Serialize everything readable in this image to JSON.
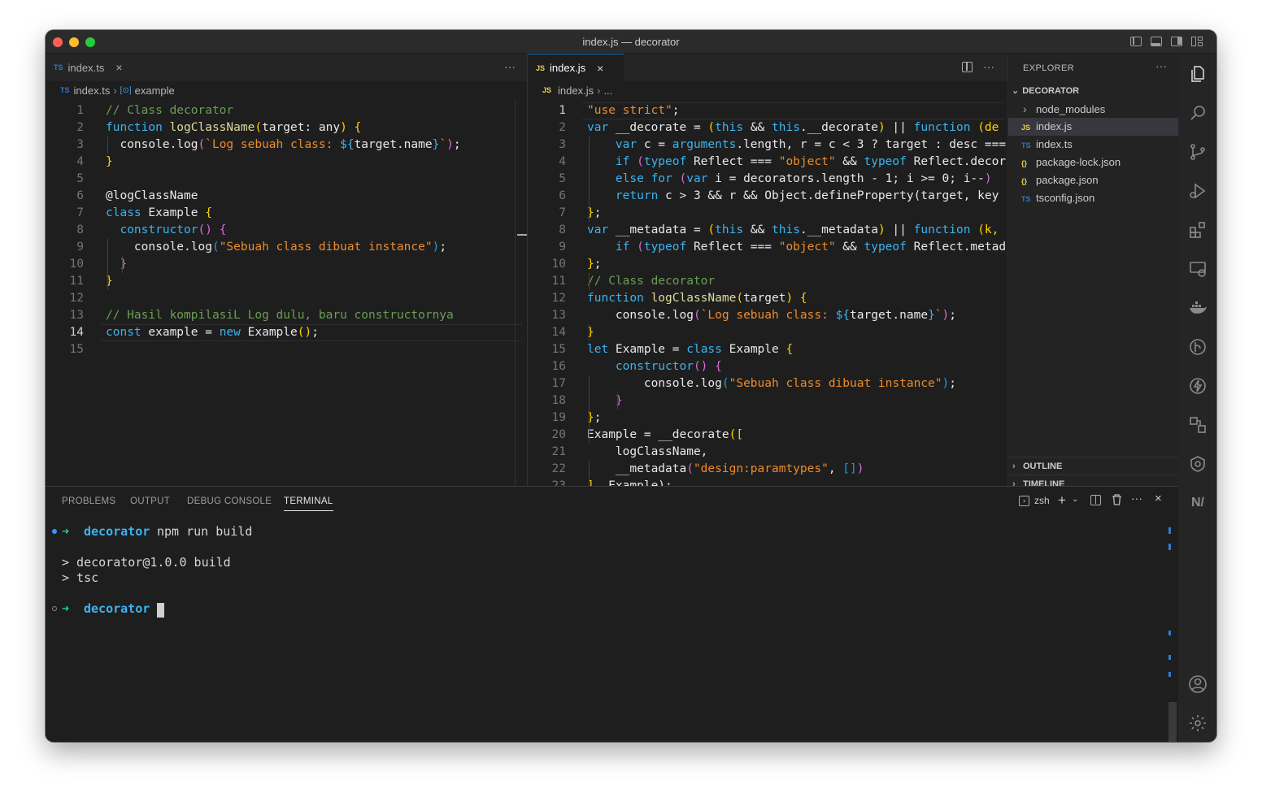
{
  "window": {
    "title": "index.js — decorator"
  },
  "left_editor": {
    "tab": {
      "type": "TS",
      "name": "index.ts"
    },
    "breadcrumb": {
      "file": "index.ts",
      "symbol": "example"
    },
    "active_line": 14,
    "lines": [
      [
        [
          "c",
          "// Class decorator"
        ]
      ],
      [
        [
          "k",
          "function "
        ],
        [
          "n",
          "logClassName"
        ],
        [
          "p",
          "("
        ],
        [
          "f",
          "target: any"
        ],
        [
          "p",
          ") {"
        ]
      ],
      [
        [
          "f",
          "  console.log"
        ],
        [
          "m",
          "("
        ],
        [
          "s",
          "`Log sebuah class: "
        ],
        [
          "k",
          "${"
        ],
        [
          "f",
          "target.name"
        ],
        [
          "k",
          "}"
        ],
        [
          "s",
          "`"
        ],
        [
          "m",
          ")"
        ],
        [
          "f",
          ";"
        ]
      ],
      [
        [
          "p",
          "}"
        ]
      ],
      [
        [
          "f",
          ""
        ]
      ],
      [
        [
          "f",
          "@logClassName"
        ]
      ],
      [
        [
          "k",
          "class "
        ],
        [
          "f",
          "Example "
        ],
        [
          "p",
          "{"
        ]
      ],
      [
        [
          "k",
          "  constructor"
        ],
        [
          "m",
          "() {"
        ]
      ],
      [
        [
          "f",
          "    console.log"
        ],
        [
          "b",
          "("
        ],
        [
          "s",
          "\"Sebuah class dibuat instance\""
        ],
        [
          "b",
          ")"
        ],
        [
          "f",
          ";"
        ]
      ],
      [
        [
          "m",
          "  }"
        ]
      ],
      [
        [
          "p",
          "}"
        ]
      ],
      [
        [
          "f",
          ""
        ]
      ],
      [
        [
          "c",
          "// Hasil kompilasiL Log dulu, baru constructornya"
        ]
      ],
      [
        [
          "k",
          "const "
        ],
        [
          "f",
          "example = "
        ],
        [
          "k",
          "new "
        ],
        [
          "f",
          "Example"
        ],
        [
          "p",
          "()"
        ],
        [
          "f",
          ";"
        ]
      ],
      [
        [
          "f",
          ""
        ]
      ]
    ]
  },
  "right_editor": {
    "tab": {
      "type": "JS",
      "name": "index.js"
    },
    "breadcrumb": {
      "file": "index.js",
      "symbol": "..."
    },
    "active_line": 1,
    "lines": [
      [
        [
          "s",
          "\"use strict\""
        ],
        [
          "f",
          ";"
        ]
      ],
      [
        [
          "k",
          "var "
        ],
        [
          "f",
          "__decorate = "
        ],
        [
          "p",
          "("
        ],
        [
          "k",
          "this "
        ],
        [
          "f",
          "&& "
        ],
        [
          "k",
          "this"
        ],
        [
          "f",
          ".__decorate"
        ],
        [
          "p",
          ")"
        ],
        [
          "f",
          " || "
        ],
        [
          "k",
          "function "
        ],
        [
          "p",
          "(de"
        ]
      ],
      [
        [
          "k",
          "    var "
        ],
        [
          "f",
          "c = "
        ],
        [
          "k",
          "arguments"
        ],
        [
          "f",
          ".length, r = c < 3 ? target : desc ==="
        ]
      ],
      [
        [
          "k",
          "    if "
        ],
        [
          "m",
          "("
        ],
        [
          "k",
          "typeof "
        ],
        [
          "f",
          "Reflect === "
        ],
        [
          "s",
          "\"object\""
        ],
        [
          "f",
          " && "
        ],
        [
          "k",
          "typeof "
        ],
        [
          "f",
          "Reflect.decor"
        ]
      ],
      [
        [
          "k",
          "    else for "
        ],
        [
          "m",
          "("
        ],
        [
          "k",
          "var "
        ],
        [
          "f",
          "i = decorators.length - 1; i >= 0; i--"
        ],
        [
          "m",
          ")"
        ]
      ],
      [
        [
          "k",
          "    return "
        ],
        [
          "f",
          "c > 3 && r && Object.defineProperty(target, key"
        ]
      ],
      [
        [
          "p",
          "}"
        ],
        [
          "f",
          ";"
        ]
      ],
      [
        [
          "k",
          "var "
        ],
        [
          "f",
          "__metadata = "
        ],
        [
          "p",
          "("
        ],
        [
          "k",
          "this "
        ],
        [
          "f",
          "&& "
        ],
        [
          "k",
          "this"
        ],
        [
          "f",
          ".__metadata"
        ],
        [
          "p",
          ")"
        ],
        [
          "f",
          " || "
        ],
        [
          "k",
          "function "
        ],
        [
          "p",
          "(k,"
        ]
      ],
      [
        [
          "k",
          "    if "
        ],
        [
          "m",
          "("
        ],
        [
          "k",
          "typeof "
        ],
        [
          "f",
          "Reflect === "
        ],
        [
          "s",
          "\"object\""
        ],
        [
          "f",
          " && "
        ],
        [
          "k",
          "typeof "
        ],
        [
          "f",
          "Reflect.metad"
        ]
      ],
      [
        [
          "p",
          "}"
        ],
        [
          "f",
          ";"
        ]
      ],
      [
        [
          "c",
          "// Class decorator"
        ]
      ],
      [
        [
          "k",
          "function "
        ],
        [
          "n",
          "logClassName"
        ],
        [
          "p",
          "("
        ],
        [
          "f",
          "target"
        ],
        [
          "p",
          ") {"
        ]
      ],
      [
        [
          "f",
          "    console.log"
        ],
        [
          "m",
          "("
        ],
        [
          "s",
          "`Log sebuah class: "
        ],
        [
          "k",
          "${"
        ],
        [
          "f",
          "target.name"
        ],
        [
          "k",
          "}"
        ],
        [
          "s",
          "`"
        ],
        [
          "m",
          ")"
        ],
        [
          "f",
          ";"
        ]
      ],
      [
        [
          "p",
          "}"
        ]
      ],
      [
        [
          "k",
          "let "
        ],
        [
          "f",
          "Example = "
        ],
        [
          "k",
          "class "
        ],
        [
          "f",
          "Example "
        ],
        [
          "p",
          "{"
        ]
      ],
      [
        [
          "k",
          "    constructor"
        ],
        [
          "m",
          "() {"
        ]
      ],
      [
        [
          "f",
          "        console.log"
        ],
        [
          "b",
          "("
        ],
        [
          "s",
          "\"Sebuah class dibuat instance\""
        ],
        [
          "b",
          ")"
        ],
        [
          "f",
          ";"
        ]
      ],
      [
        [
          "m",
          "    }"
        ]
      ],
      [
        [
          "p",
          "}"
        ],
        [
          "f",
          ";"
        ]
      ],
      [
        [
          "f",
          "Example = __decorate"
        ],
        [
          "p",
          "(["
        ]
      ],
      [
        [
          "f",
          "    logClassName,"
        ]
      ],
      [
        [
          "f",
          "    __metadata"
        ],
        [
          "m",
          "("
        ],
        [
          "s",
          "\"design:paramtypes\""
        ],
        [
          "f",
          ", "
        ],
        [
          "b",
          "[]"
        ],
        [
          "m",
          ")"
        ]
      ],
      [
        [
          "p",
          "]"
        ],
        [
          "f",
          ", Example);"
        ]
      ]
    ]
  },
  "explorer": {
    "title": "EXPLORER",
    "root": "DECORATOR",
    "items": [
      {
        "icon": "folder",
        "name": "node_modules"
      },
      {
        "icon": "JS",
        "name": "index.js"
      },
      {
        "icon": "TS",
        "name": "index.ts"
      },
      {
        "icon": "{}",
        "name": "package-lock.json"
      },
      {
        "icon": "{}",
        "name": "package.json"
      },
      {
        "icon": "TS",
        "name": "tsconfig.json"
      }
    ],
    "outline": "OUTLINE",
    "timeline": "TIMELINE"
  },
  "panel": {
    "tabs": [
      "PROBLEMS",
      "OUTPUT",
      "DEBUG CONSOLE",
      "TERMINAL"
    ],
    "active_tab": "TERMINAL",
    "shell": "zsh"
  },
  "terminal": {
    "prompt_dir": "decorator",
    "command": "npm run build",
    "output": [
      "> decorator@1.0.0 build",
      "> tsc"
    ],
    "prompt2_dir": "decorator"
  },
  "colors": {
    "ts": "#3178c6",
    "js": "#e8d44d",
    "accent": "#0078d4",
    "prompt": "#3bb4f2",
    "arrow": "#23d18b"
  },
  "activity_icons": [
    "files-icon",
    "search-icon",
    "source-control-icon",
    "run-debug-icon",
    "extensions-icon",
    "remote-explorer-icon",
    "docker-icon",
    "gitlens-icon",
    "thunder-client-icon",
    "live-share-icon",
    "security-icon",
    "nx-icon",
    "account-icon",
    "settings-icon"
  ]
}
